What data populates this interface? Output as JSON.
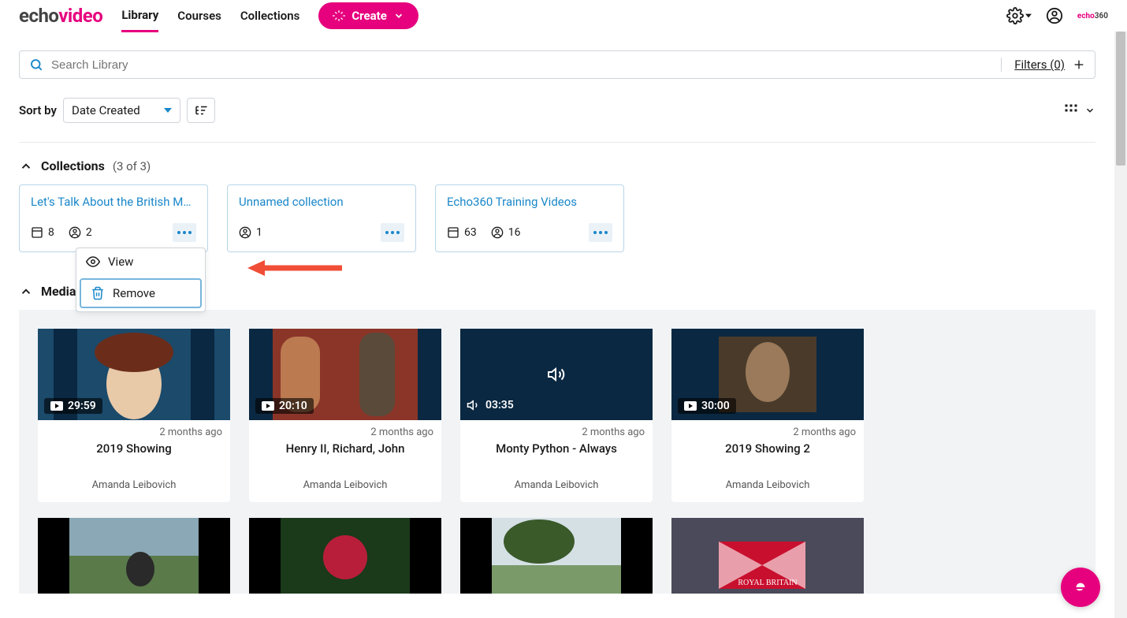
{
  "brand": {
    "part1": "echo",
    "part2": "video"
  },
  "nav": {
    "library": "Library",
    "courses": "Courses",
    "collections": "Collections"
  },
  "create": {
    "label": "Create"
  },
  "small_logo": {
    "p1": "echo",
    "p2": "360"
  },
  "search": {
    "placeholder": "Search Library"
  },
  "filters": {
    "label": "Filters (0)"
  },
  "sort": {
    "label": "Sort by",
    "value": "Date Created"
  },
  "sections": {
    "collections": {
      "title": "Collections",
      "count": "(3 of 3)"
    },
    "media": {
      "title": "Media"
    }
  },
  "collections": [
    {
      "title": "Let's Talk About the British Mo...",
      "media_count": "8",
      "member_count": "2"
    },
    {
      "title": "Unnamed collection",
      "media_count": "",
      "member_count": "1"
    },
    {
      "title": "Echo360 Training Videos",
      "media_count": "63",
      "member_count": "16"
    }
  ],
  "dropdown": {
    "view": "View",
    "remove": "Remove"
  },
  "media_items": [
    {
      "duration": "29:59",
      "type": "video",
      "date": "2 months ago",
      "title": "2019 Showing",
      "author": "Amanda Leibovich"
    },
    {
      "duration": "20:10",
      "type": "video",
      "date": "2 months ago",
      "title": "Henry II, Richard, John",
      "author": "Amanda Leibovich"
    },
    {
      "duration": "03:35",
      "type": "audio",
      "date": "2 months ago",
      "title": "Monty Python - Always",
      "author": "Amanda Leibovich"
    },
    {
      "duration": "30:00",
      "type": "video",
      "date": "2 months ago",
      "title": "2019 Showing 2",
      "author": "Amanda Leibovich"
    }
  ]
}
